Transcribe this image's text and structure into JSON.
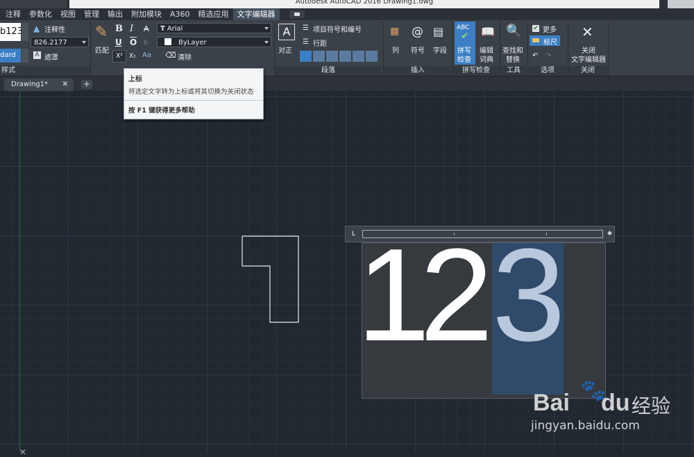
{
  "title_bar": {
    "text": "Autodesk AutoCAD 2016    Drawing1.dwg"
  },
  "menu_tabs": [
    {
      "label": "注释"
    },
    {
      "label": "参数化"
    },
    {
      "label": "视图"
    },
    {
      "label": "管理"
    },
    {
      "label": "输出"
    },
    {
      "label": "附加模块"
    },
    {
      "label": "A360"
    },
    {
      "label": "精选应用"
    },
    {
      "label": "文字编辑器",
      "active": true
    }
  ],
  "style_panel": {
    "style_preview": "b123",
    "style_name": "dard",
    "annotative_label": "注释性",
    "height_value": "826.2177",
    "mask_label": "遮罩",
    "panel_title": "样式"
  },
  "format_panel": {
    "match_label": "匹配",
    "bold": "B",
    "italic": "I",
    "strike": "A",
    "underline": "U",
    "overline": "O",
    "superscript": "X²",
    "subscript": "X₂",
    "case": "Aa",
    "font_value": "Arial",
    "color_value": "ByLayer",
    "clear_label": "清除",
    "panel_title": "格式"
  },
  "paragraph_panel": {
    "justify_label": "对正",
    "bullets_label": "项目符号和编号",
    "line_spacing_label": "行距",
    "panel_title": "段落"
  },
  "insert_panel": {
    "columns_label": "列",
    "symbol_label": "符号",
    "field_label": "字段",
    "panel_title": "插入"
  },
  "spell_panel": {
    "check_label": "拼写\n检查",
    "check_line1": "拼写",
    "check_line2": "检查",
    "dict_line1": "编辑",
    "dict_line2": "词典",
    "abc": "ABC",
    "panel_title": "拼写检查"
  },
  "tools_panel": {
    "find_line1": "查找和",
    "find_line2": "替换",
    "panel_title": "工具"
  },
  "options_panel": {
    "more_label": "更多",
    "ruler_label": "标尺",
    "panel_title": "选项"
  },
  "close_panel": {
    "close_line1": "关闭",
    "close_line2": "文字编辑器",
    "panel_title": "关闭"
  },
  "doc_tab": {
    "label": "Drawing1*"
  },
  "tooltip": {
    "title": "上标",
    "description": "将选定文字转为上标或将其切换为关闭状态",
    "help": "按 F1 键获得更多帮助"
  },
  "editor_text": {
    "normal": "12",
    "d1": "1",
    "d2": "2",
    "selected": "3"
  },
  "watermark": {
    "brand": "Bai",
    "brand2": "du",
    "cn": "经验",
    "url": "jingyan.baidu.com"
  },
  "colors": {
    "canvas": "#212830",
    "ribbon": "#3b4148",
    "active_tab": "#43505e",
    "selection": "#2f4a6b",
    "highlight": "#3c7fc4"
  }
}
